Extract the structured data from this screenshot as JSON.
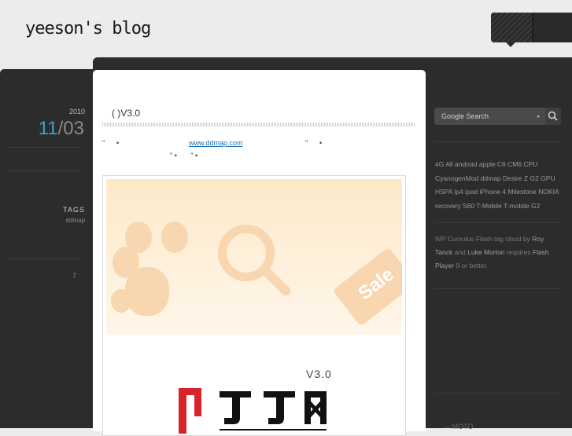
{
  "site": {
    "title": "yeeson's blog"
  },
  "post": {
    "year": "2010",
    "month": "11",
    "slash": "/",
    "day": "03",
    "tags_label": "TAGS",
    "tags_value": "ddmap",
    "comments_count": "7",
    "title": "( )V3.0",
    "body_link": "www.ddmap.com",
    "body_line1_marks": [
      "\"",
      "•",
      "\"",
      "•"
    ],
    "body_line2": "\" •       \" •",
    "image": {
      "version_label": "V3.0",
      "sale_text": "Sale"
    }
  },
  "sidebar": {
    "search_label": "Google Search",
    "search_arrow": "▸",
    "tag_cloud": "4G All android apple C6 CM6 CPU CyanogenMod ddmap Desire Z G2 GPU HSPA ip4 ipad iPhone 4 Milestone NOKIA recovery S60 T-Mobile T-mobile G2",
    "wp_cumulus": {
      "prefix": "WP Cumulus",
      "text1": "Flash tag cloud by",
      "author1": "Roy Tanck",
      "and": "and",
      "author2": "Luke Morton",
      "requires": "requires",
      "flash": "Flash Player",
      "rest": "9 or better."
    },
    "bottom_text": "— MOTO"
  },
  "colors": {
    "accent": "#3aa0d8",
    "link": "#1a6fb3",
    "dark_panel": "#2c2c2c",
    "page_bg": "#ececec"
  }
}
